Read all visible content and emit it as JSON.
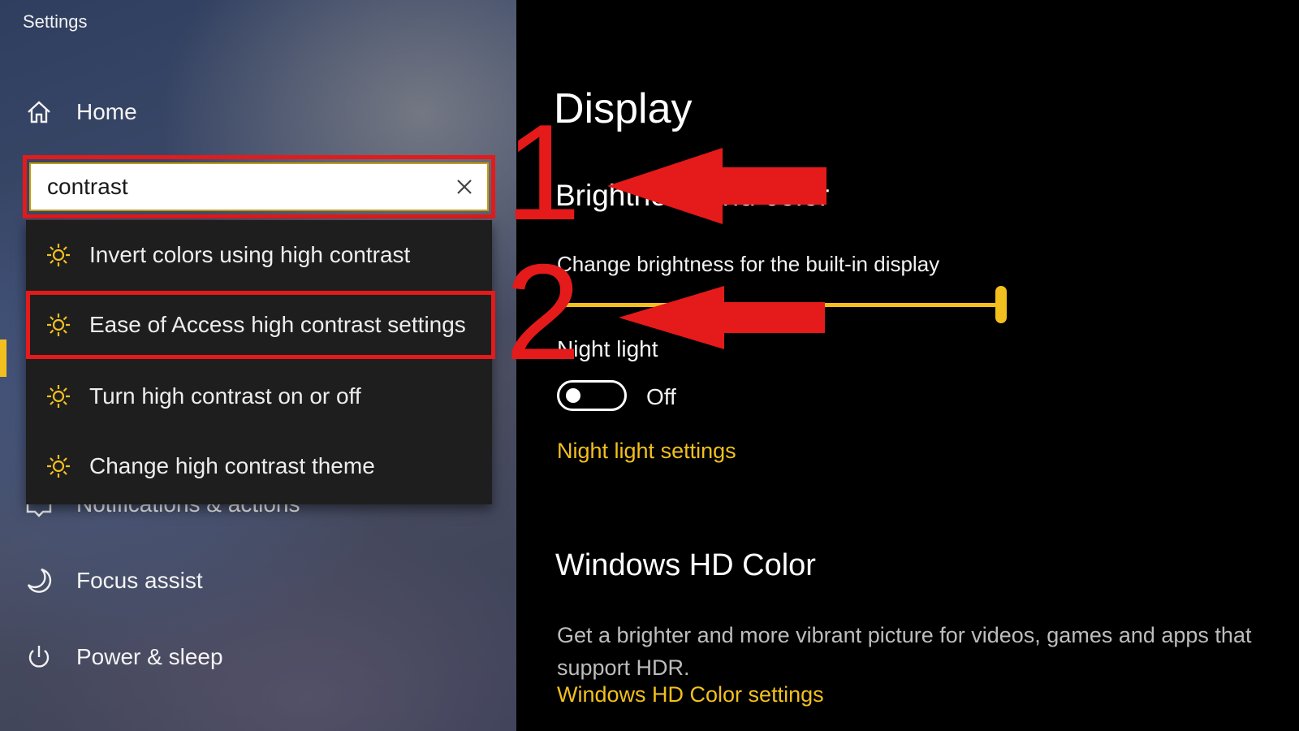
{
  "window": {
    "title": "Settings"
  },
  "sidebar": {
    "home_label": "Home",
    "items": [
      {
        "label": "Notifications & actions",
        "icon": "notifications-icon"
      },
      {
        "label": "Focus assist",
        "icon": "moon-icon"
      },
      {
        "label": "Power & sleep",
        "icon": "power-icon"
      }
    ]
  },
  "search": {
    "value": "contrast",
    "suggestions": [
      {
        "label": "Invert colors using high contrast",
        "icon": "sun-icon"
      },
      {
        "label": "Ease of Access high contrast settings",
        "icon": "sun-icon"
      },
      {
        "label": "Turn high contrast on or off",
        "icon": "sun-icon"
      },
      {
        "label": "Change high contrast theme",
        "icon": "sun-icon"
      }
    ]
  },
  "main": {
    "title": "Display",
    "brightness_section": "Brightness and color",
    "brightness_label": "Change brightness for the built-in display",
    "brightness_value": 1.0,
    "night_light_label": "Night light",
    "night_light_state": "Off",
    "night_light_link": "Night light settings",
    "hd_title": "Windows HD Color",
    "hd_desc": "Get a brighter and more vibrant picture for videos, games and apps that support HDR.",
    "hd_link": "Windows HD Color settings"
  },
  "annotations": {
    "step1": "1",
    "step2": "2"
  },
  "colors": {
    "accent": "#f2c01e",
    "highlight": "#e51a1a",
    "background": "#000000"
  }
}
